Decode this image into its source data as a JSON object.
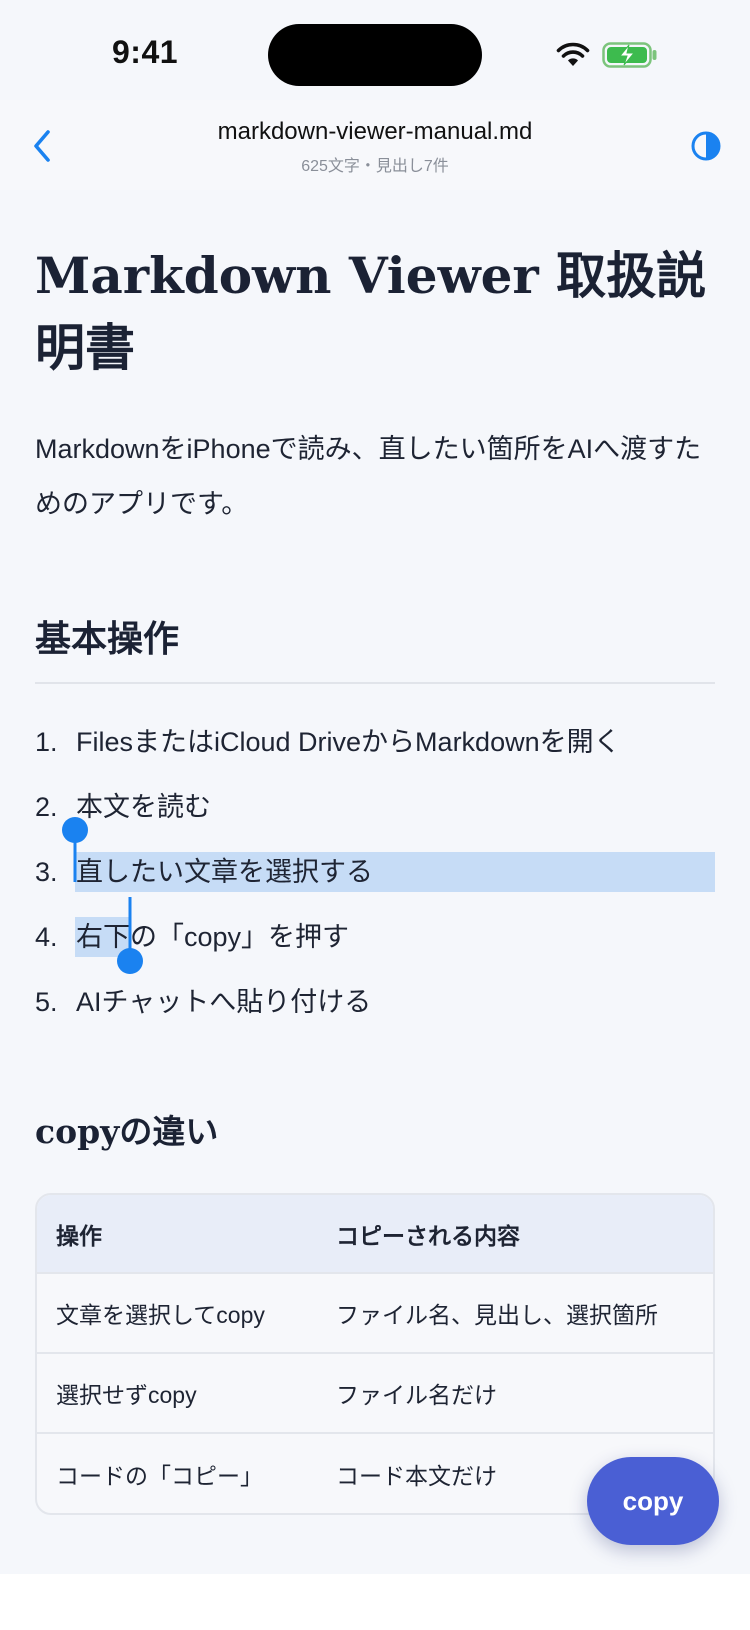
{
  "status_bar": {
    "time": "9:41"
  },
  "header": {
    "title": "markdown-viewer-manual.md",
    "subtitle": "625文字・見出し7件",
    "back_icon": "chevron-left-icon",
    "theme_icon": "half-circle-contrast-icon"
  },
  "document": {
    "title": "Markdown Viewer 取扱説明書",
    "intro": "MarkdownをiPhoneで読み、直したい箇所をAIへ渡すためのアプリです。",
    "section_basic": {
      "heading": "基本操作",
      "steps": [
        {
          "num": "1.",
          "text": "FilesまたはiCloud DriveからMarkdownを開く"
        },
        {
          "num": "2.",
          "text": "本文を読む"
        },
        {
          "num": "3.",
          "text": "直したい文章を選択する"
        },
        {
          "num": "4.",
          "text": "右下の「copy」を押す"
        },
        {
          "num": "5.",
          "text": "AIチャットへ貼り付ける"
        }
      ]
    },
    "section_copy": {
      "heading": "copyの違い",
      "table": {
        "headers": [
          "操作",
          "コピーされる内容"
        ],
        "rows": [
          [
            "文章を選択してcopy",
            "ファイル名、見出し、選択箇所"
          ],
          [
            "選択せずcopy",
            "ファイル名だけ"
          ],
          [
            "コードの「コピー」",
            "コード本文だけ"
          ]
        ]
      }
    }
  },
  "fab": {
    "label": "copy"
  },
  "colors": {
    "accent": "#1a82f0",
    "selection": "#c6dcf6",
    "fab": "#4a5fd4",
    "background": "#f5f7fb"
  }
}
